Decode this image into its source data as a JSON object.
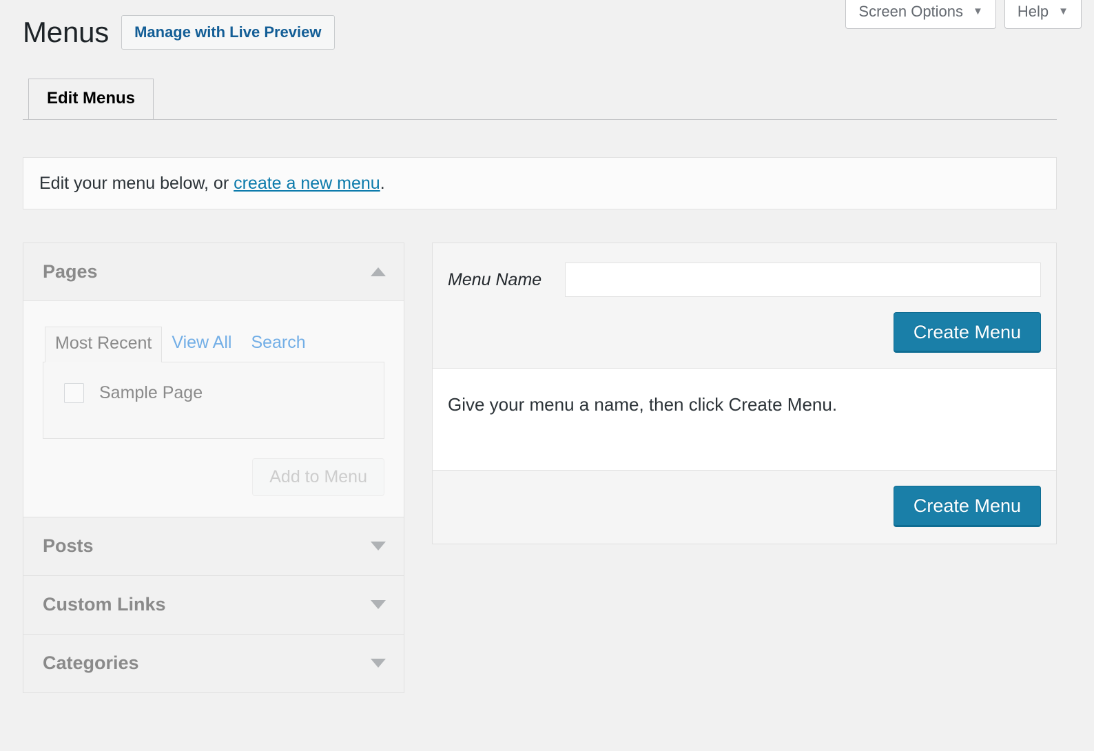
{
  "screen_meta": {
    "buttons": [
      {
        "label": "Screen Options",
        "caret": "▼",
        "icon": "chevron-down-icon"
      },
      {
        "label": "Help",
        "caret": "▼",
        "icon": "chevron-down-icon"
      }
    ]
  },
  "header": {
    "title": "Menus",
    "action_label": "Manage with Live Preview"
  },
  "tabs": [
    {
      "label": "Edit Menus",
      "active": true
    }
  ],
  "notice": {
    "text_before": "Edit your menu below, or ",
    "link_label": "create a new menu",
    "text_after": "."
  },
  "accordions": [
    {
      "title": "Pages",
      "open": true,
      "toggle_icon": "chevron-up-icon",
      "tabs": [
        {
          "label": "Most Recent",
          "active": true
        },
        {
          "label": "View All",
          "active": false
        },
        {
          "label": "Search",
          "active": false
        }
      ],
      "items": [
        {
          "label": "Sample Page",
          "checked": false
        }
      ],
      "add_button_label": "Add to Menu"
    },
    {
      "title": "Posts",
      "open": false,
      "toggle_icon": "chevron-down-icon"
    },
    {
      "title": "Custom Links",
      "open": false,
      "toggle_icon": "chevron-down-icon"
    },
    {
      "title": "Categories",
      "open": false,
      "toggle_icon": "chevron-down-icon"
    }
  ],
  "menu_editor": {
    "menu_name_label": "Menu Name",
    "menu_name_value": "",
    "menu_name_placeholder": "",
    "create_button_top_label": "Create Menu",
    "instruction": "Give your menu a name, then click Create Menu.",
    "create_button_bottom_label": "Create Menu"
  },
  "colors": {
    "accent_blue": "#1a7fa8",
    "link_blue": "#0b7aab",
    "tab_link_blue": "#72aee6",
    "page_bg": "#f1f1f1"
  }
}
